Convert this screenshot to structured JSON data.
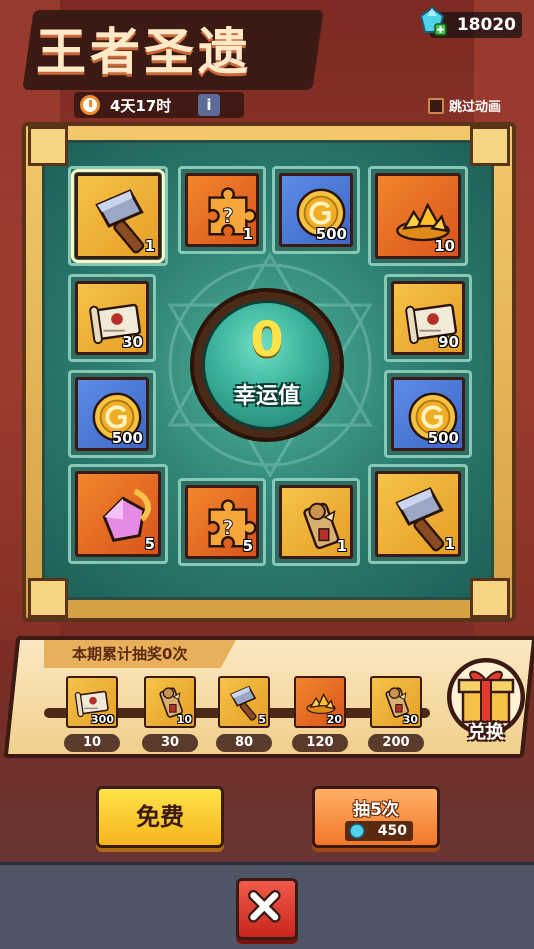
{
  "header": {
    "title": "王者圣遗",
    "timer": "4天17时",
    "info_label": "i",
    "gems": "18020",
    "skip_label": "跳过动画"
  },
  "board": {
    "luck_value": "0",
    "luck_label": "幸运值",
    "slots": [
      {
        "item": "hammer",
        "bg": "gold",
        "qty": "1",
        "selected": true
      },
      {
        "item": "puzzle",
        "bg": "orange",
        "qty": "1"
      },
      {
        "item": "coin",
        "bg": "blue",
        "qty": "500"
      },
      {
        "item": "gold-pile",
        "bg": "orange",
        "qty": "10"
      },
      {
        "item": "scroll",
        "bg": "gold",
        "qty": "30"
      },
      {
        "item": "scroll",
        "bg": "gold",
        "qty": "90"
      },
      {
        "item": "coin",
        "bg": "blue",
        "qty": "500"
      },
      {
        "item": "coin",
        "bg": "blue",
        "qty": "500"
      },
      {
        "item": "crystal",
        "bg": "orange",
        "qty": "5"
      },
      {
        "item": "puzzle",
        "bg": "orange",
        "qty": "5"
      },
      {
        "item": "relic-scroll",
        "bg": "gold",
        "qty": "1"
      },
      {
        "item": "hammer",
        "bg": "gold",
        "qty": "1"
      }
    ]
  },
  "progress": {
    "title": "本期累计抽奖0次",
    "milestones": [
      {
        "item": "scroll",
        "qty": "300",
        "count": "10",
        "bg": "gold"
      },
      {
        "item": "relic-scroll",
        "qty": "10",
        "count": "30",
        "bg": "gold"
      },
      {
        "item": "hammer",
        "qty": "5",
        "count": "80",
        "bg": "gold"
      },
      {
        "item": "gold-pile",
        "qty": "20",
        "count": "120",
        "bg": "orange"
      },
      {
        "item": "relic-scroll",
        "qty": "30",
        "count": "200",
        "bg": "gold"
      }
    ],
    "exchange_label": "兑换"
  },
  "buttons": {
    "free_label": "免费",
    "draw5_label": "抽5次",
    "draw5_cost": "450"
  },
  "colors": {
    "accent_gold": "#f6c348",
    "board_teal": "#2f8274",
    "close_red": "#e23b2e"
  }
}
